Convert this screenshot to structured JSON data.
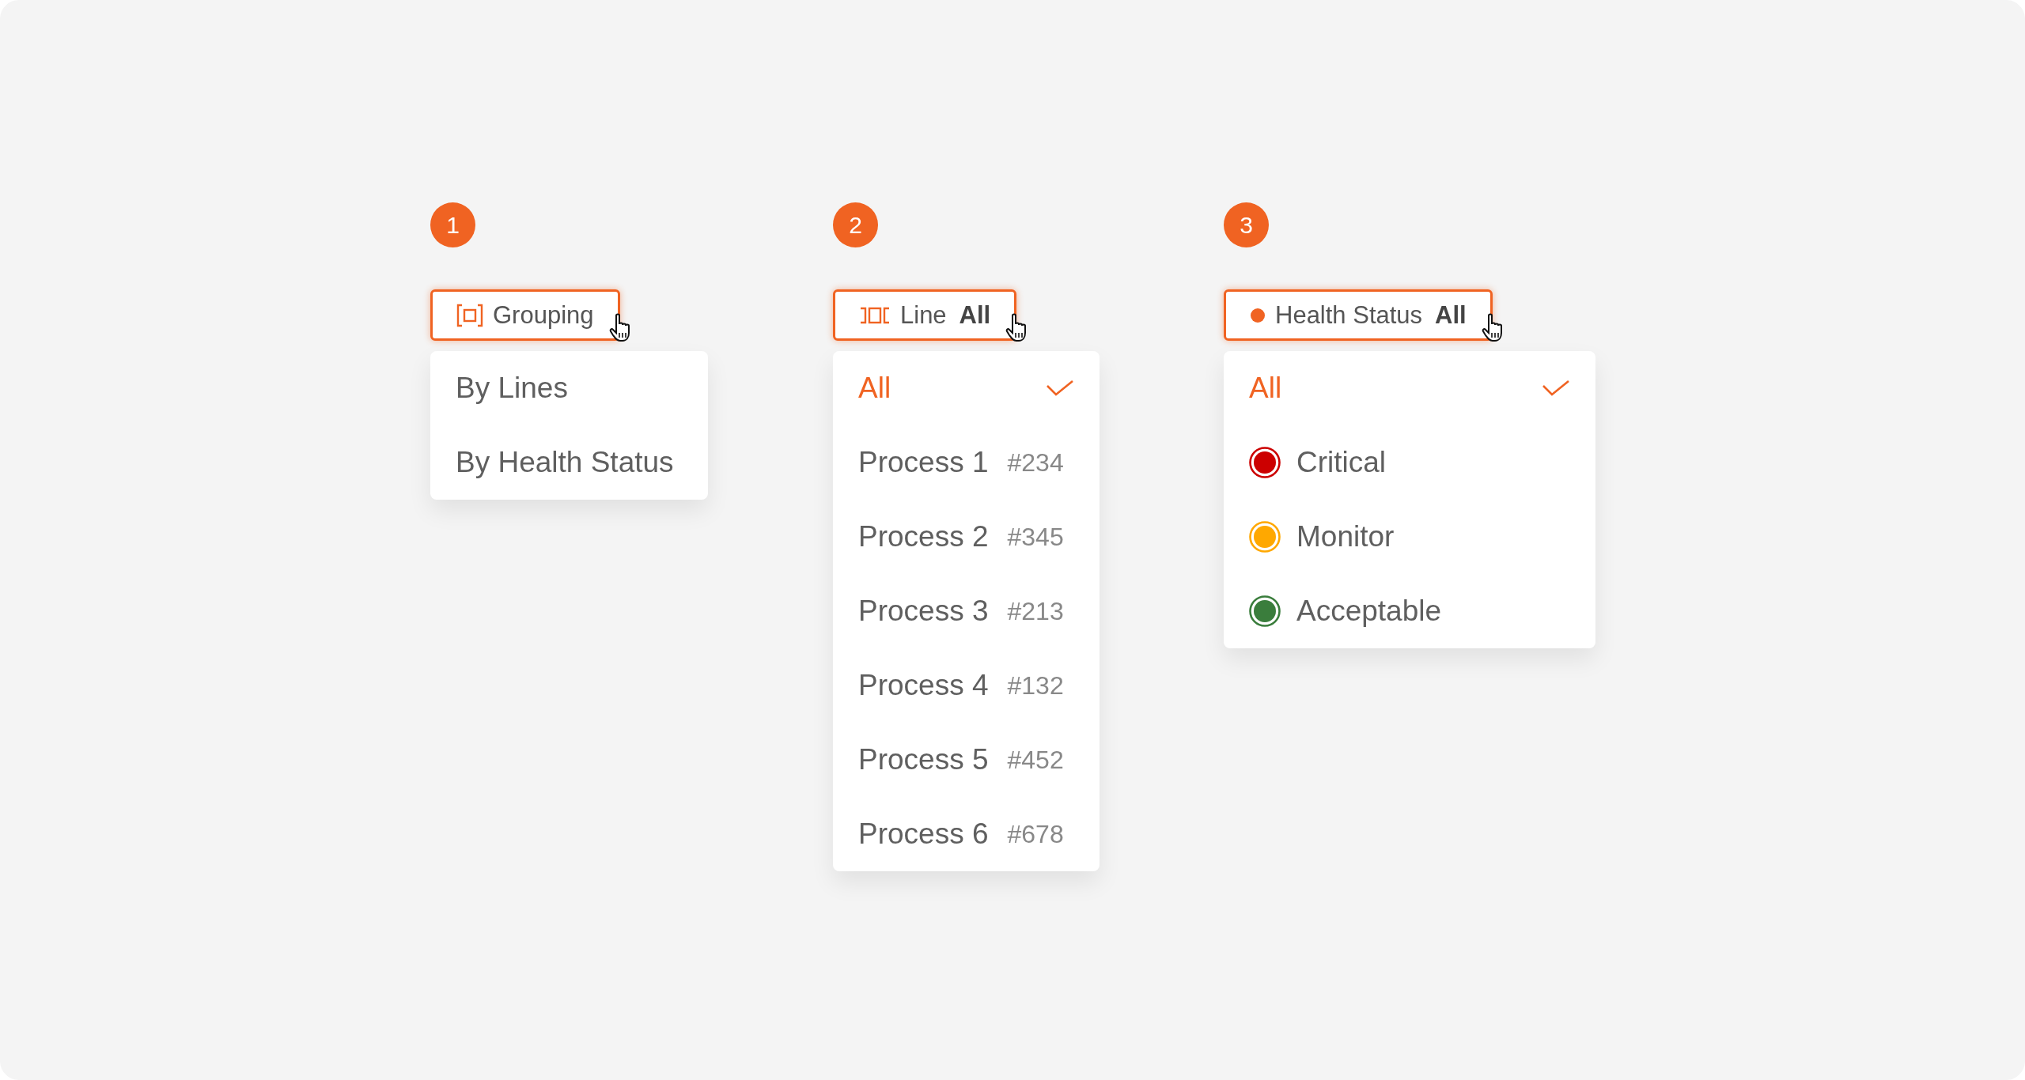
{
  "steps": [
    {
      "number": "1",
      "button": {
        "kind": "grouping",
        "label": "Grouping"
      },
      "menu": {
        "items": [
          {
            "kind": "plain",
            "label": "By Lines",
            "selected": false
          },
          {
            "kind": "plain",
            "label": "By Health Status",
            "selected": false
          }
        ]
      }
    },
    {
      "number": "2",
      "button": {
        "kind": "line",
        "label": "Line",
        "value": "All"
      },
      "menu": {
        "items": [
          {
            "kind": "plain",
            "label": "All",
            "selected": true
          },
          {
            "kind": "process",
            "label": "Process 1",
            "code": "#234",
            "selected": false
          },
          {
            "kind": "process",
            "label": "Process 2",
            "code": "#345",
            "selected": false
          },
          {
            "kind": "process",
            "label": "Process 3",
            "code": "#213",
            "selected": false
          },
          {
            "kind": "process",
            "label": "Process 4",
            "code": "#132",
            "selected": false
          },
          {
            "kind": "process",
            "label": "Process 5",
            "code": "#452",
            "selected": false
          },
          {
            "kind": "process",
            "label": "Process 6",
            "code": "#678",
            "selected": false
          }
        ]
      }
    },
    {
      "number": "3",
      "button": {
        "kind": "status",
        "label": "Health Status",
        "value": "All"
      },
      "menu": {
        "items": [
          {
            "kind": "plain",
            "label": "All",
            "selected": true
          },
          {
            "kind": "status",
            "label": "Critical",
            "color": "#cc0000",
            "selected": false
          },
          {
            "kind": "status",
            "label": "Monitor",
            "color": "#ffa800",
            "selected": false
          },
          {
            "kind": "status",
            "label": "Acceptable",
            "color": "#3a7d3c",
            "selected": false
          }
        ]
      }
    }
  ]
}
